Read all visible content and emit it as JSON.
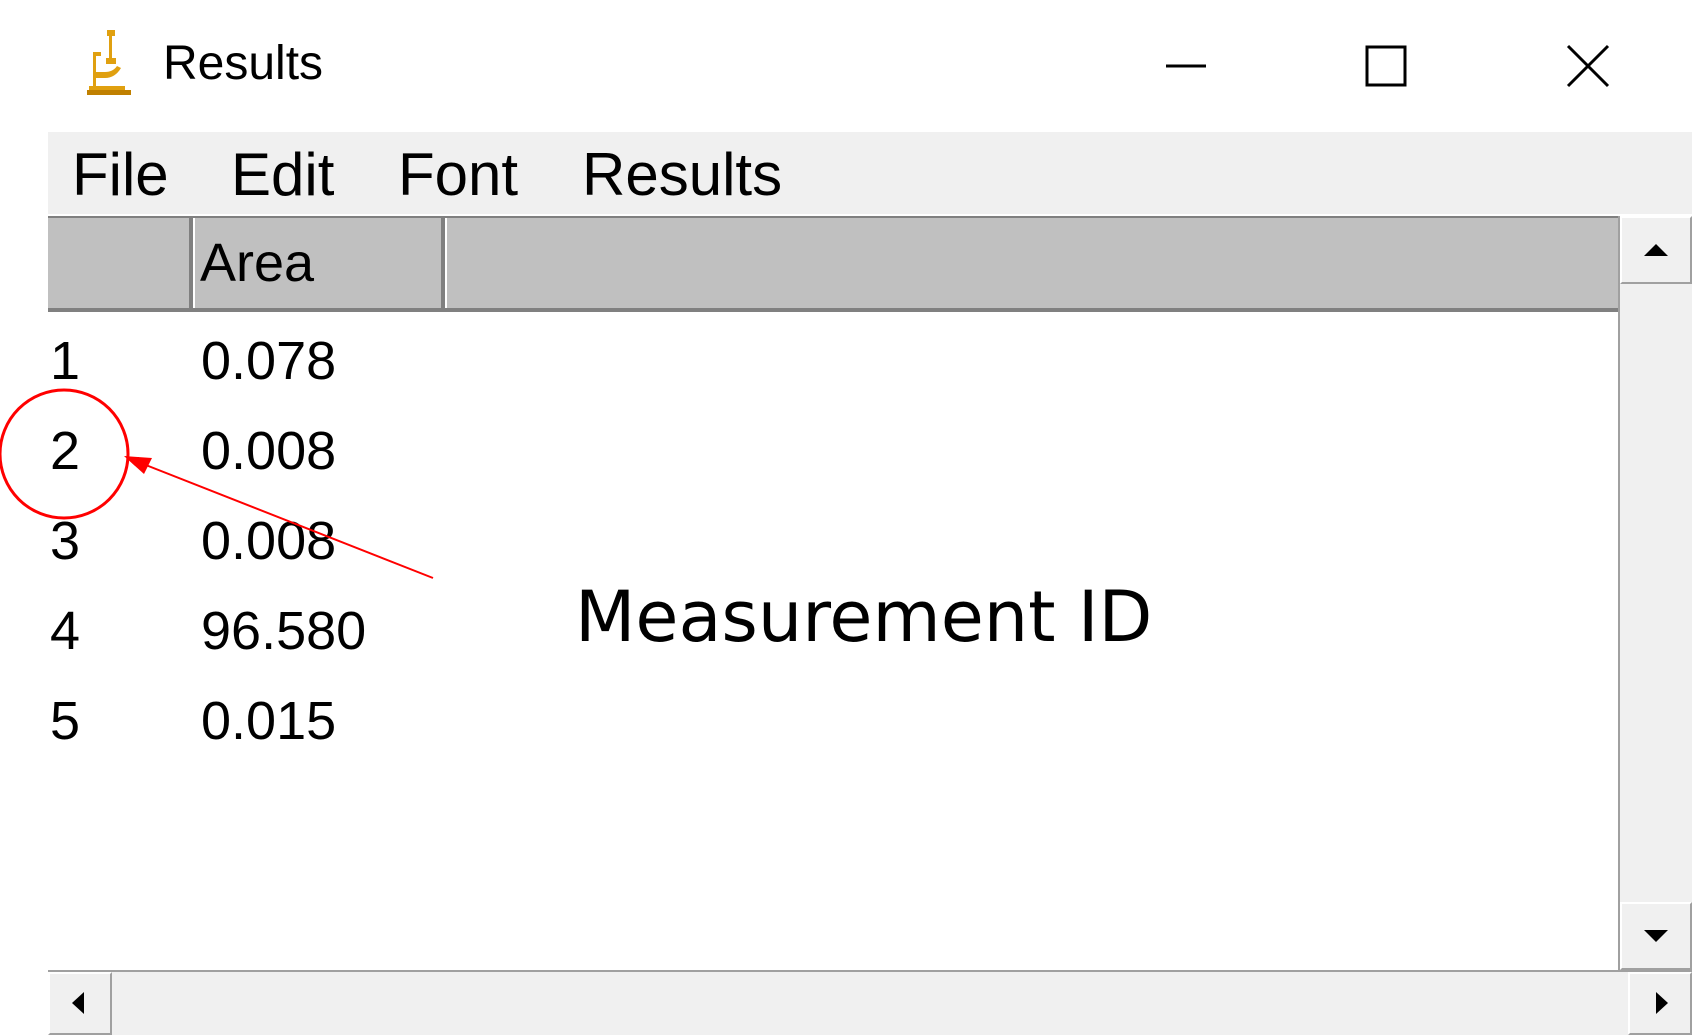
{
  "window": {
    "title": "Results",
    "icon": "microscope-icon",
    "controls": [
      "minimize-icon",
      "maximize-icon",
      "close-icon"
    ]
  },
  "menu": {
    "items": [
      {
        "label": "File"
      },
      {
        "label": "Edit"
      },
      {
        "label": "Font"
      },
      {
        "label": "Results"
      }
    ]
  },
  "table": {
    "columns": [
      "",
      "Area"
    ],
    "rows": [
      {
        "id": "1",
        "area": "0.078"
      },
      {
        "id": "2",
        "area": "0.008"
      },
      {
        "id": "3",
        "area": "0.008"
      },
      {
        "id": "4",
        "area": "96.580"
      },
      {
        "id": "5",
        "area": "0.015"
      }
    ]
  },
  "annotation": {
    "label": "Measurement ID",
    "color": "#ff0000",
    "target_row": "2"
  },
  "colors": {
    "header_bg": "#c0c0c0",
    "menu_bg": "#f0f0f0",
    "icon_gold": "#e0a010"
  }
}
